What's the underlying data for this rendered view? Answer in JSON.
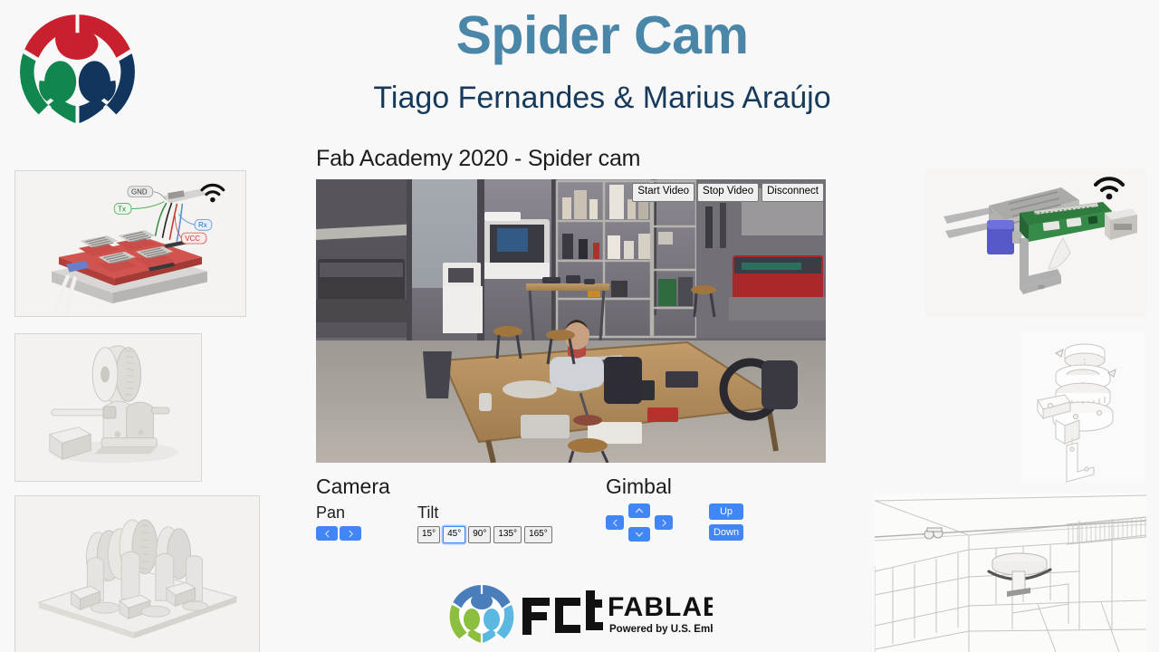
{
  "page": {
    "background_color": "#f8f8f8",
    "accent_blue": "#4285f4",
    "title_color": "#4a86a8",
    "subtitle_color": "#153a5b"
  },
  "header": {
    "title": "Spider Cam",
    "subtitle": "Tiago Fernandes & Marius Araújo",
    "logo_name": "fablab-globe-logo",
    "logo_colors": {
      "red": "#c8202e",
      "green": "#11864f",
      "navy": "#12355e"
    }
  },
  "main": {
    "section_title": "Fab Academy 2020 - Spider cam",
    "video": {
      "name": "live-video-feed",
      "alt": "Fab lab workshop live camera feed",
      "controls": [
        {
          "id": "start-video",
          "label": "Start Video"
        },
        {
          "id": "stop-video",
          "label": "Stop Video"
        },
        {
          "id": "disconnect",
          "label": "Disconnect"
        }
      ]
    }
  },
  "controls": {
    "camera": {
      "heading": "Camera",
      "pan": {
        "label": "Pan",
        "buttons": [
          {
            "id": "pan-left",
            "icon": "chevron-left-icon"
          },
          {
            "id": "pan-right",
            "icon": "chevron-right-icon"
          }
        ]
      },
      "tilt": {
        "label": "Tilt",
        "selected": "45°",
        "options": [
          "15°",
          "45°",
          "90°",
          "135°",
          "165°"
        ]
      }
    },
    "gimbal": {
      "heading": "Gimbal",
      "dpad": [
        {
          "id": "gimbal-left",
          "icon": "chevron-left-icon"
        },
        {
          "id": "gimbal-up",
          "icon": "chevron-up-icon"
        },
        {
          "id": "gimbal-right",
          "icon": "chevron-right-icon"
        },
        {
          "id": "gimbal-down",
          "icon": "chevron-down-icon"
        }
      ],
      "updown": [
        {
          "id": "gimbal-raise",
          "label": "Up"
        },
        {
          "id": "gimbal-lower",
          "label": "Down"
        }
      ]
    }
  },
  "footer": {
    "logo_name": "fct-fablab-logo",
    "brand_prefix": "FCt",
    "brand_main": "FABLAB",
    "tagline": "Powered by U.S. Embassy"
  },
  "thumbnails": {
    "left": [
      {
        "id": "thumb-cnc-shield",
        "caption": "CNC shield wiring diagram",
        "labels": [
          "GND",
          "Tx",
          "Rx",
          "VCC"
        ],
        "has_wifi_icon": true
      },
      {
        "id": "thumb-pulley-mount",
        "caption": "Pulley and motor mount render",
        "has_wifi_icon": false
      },
      {
        "id": "thumb-spool-array",
        "caption": "Spool array assembly render",
        "has_wifi_icon": false
      }
    ],
    "right": [
      {
        "id": "thumb-pi-gimbal",
        "caption": "Raspberry Pi gimbal assembly",
        "has_wifi_icon": true
      },
      {
        "id": "thumb-gimbal-exploded",
        "caption": "Gimbal exploded view",
        "has_wifi_icon": false
      },
      {
        "id": "thumb-lab-wireframe",
        "caption": "Lab room wireframe render",
        "has_wifi_icon": false
      }
    ]
  }
}
